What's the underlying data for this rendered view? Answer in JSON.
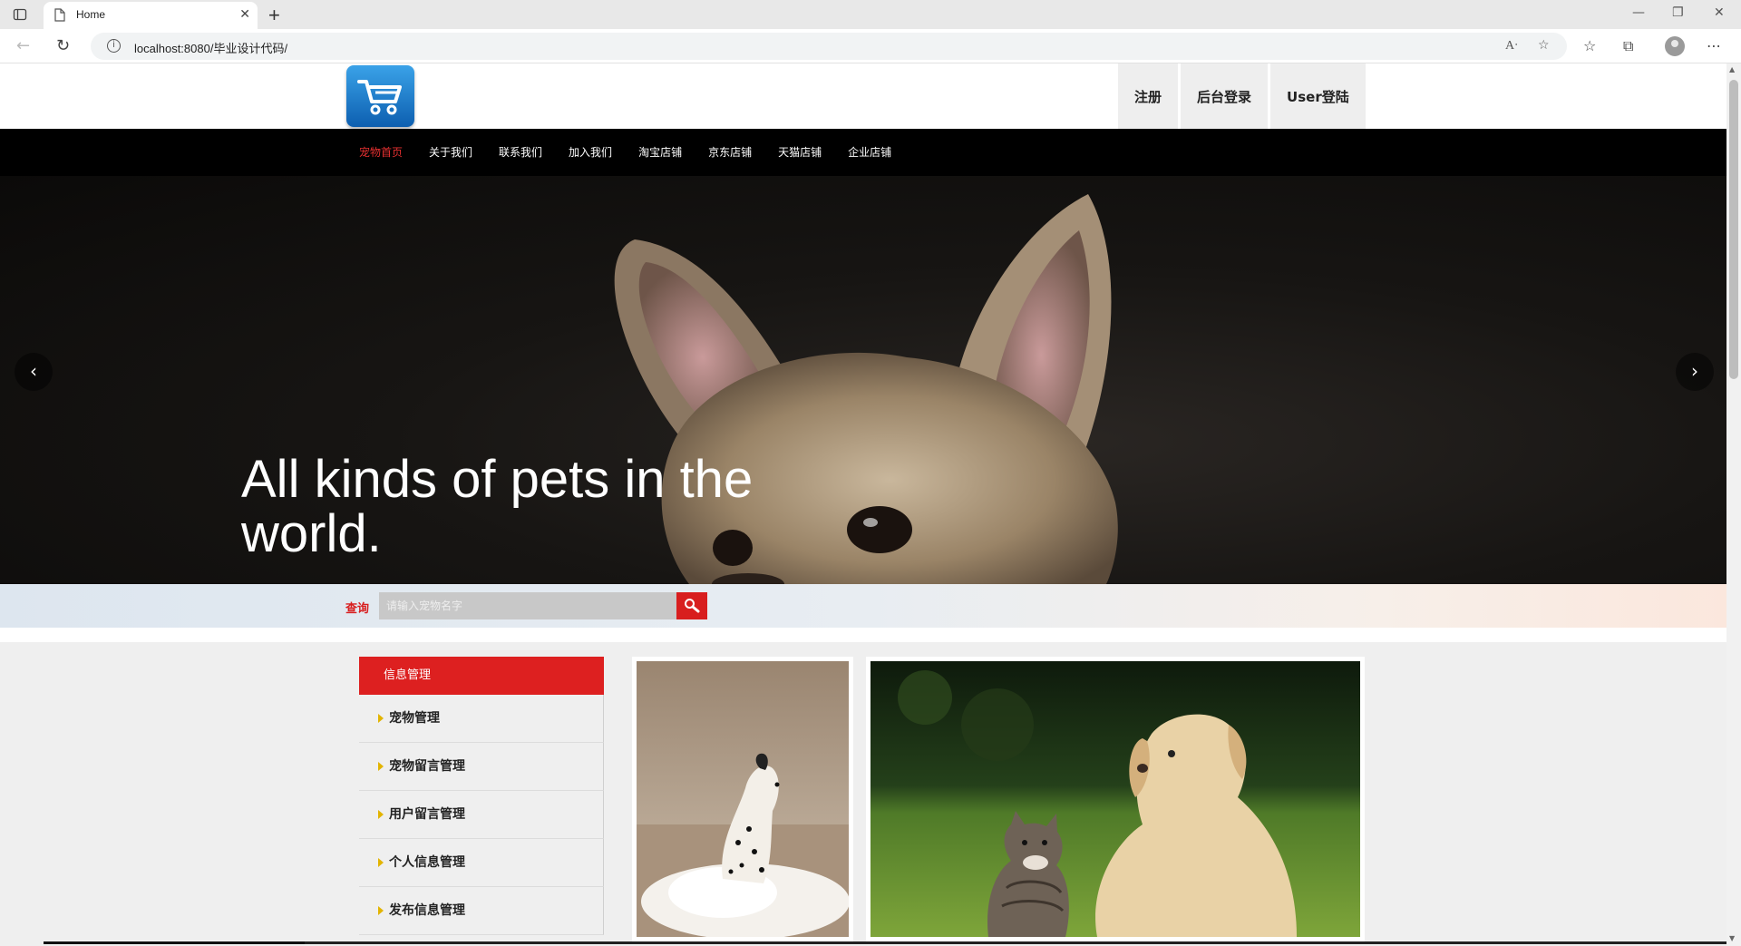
{
  "browser": {
    "tab_title": "Home",
    "url": "localhost:8080/毕业设计代码/"
  },
  "header": {
    "links": [
      "注册",
      "后台登录",
      "User登陆"
    ]
  },
  "nav": {
    "items": [
      "宠物首页",
      "关于我们",
      "联系我们",
      "加入我们",
      "淘宝店铺",
      "京东店铺",
      "天猫店铺",
      "企业店铺"
    ],
    "active_index": 0
  },
  "hero": {
    "caption": "All kinds of pets in the world."
  },
  "search": {
    "label": "查询",
    "placeholder": "请输入宠物名字"
  },
  "sidebar": {
    "heading": "信息管理",
    "items": [
      "宠物管理",
      "宠物留言管理",
      "用户留言管理",
      "个人信息管理",
      "发布信息管理"
    ]
  },
  "colors": {
    "accent": "#dd2020",
    "nav_bg": "#000000",
    "active_nav": "#e53030"
  }
}
